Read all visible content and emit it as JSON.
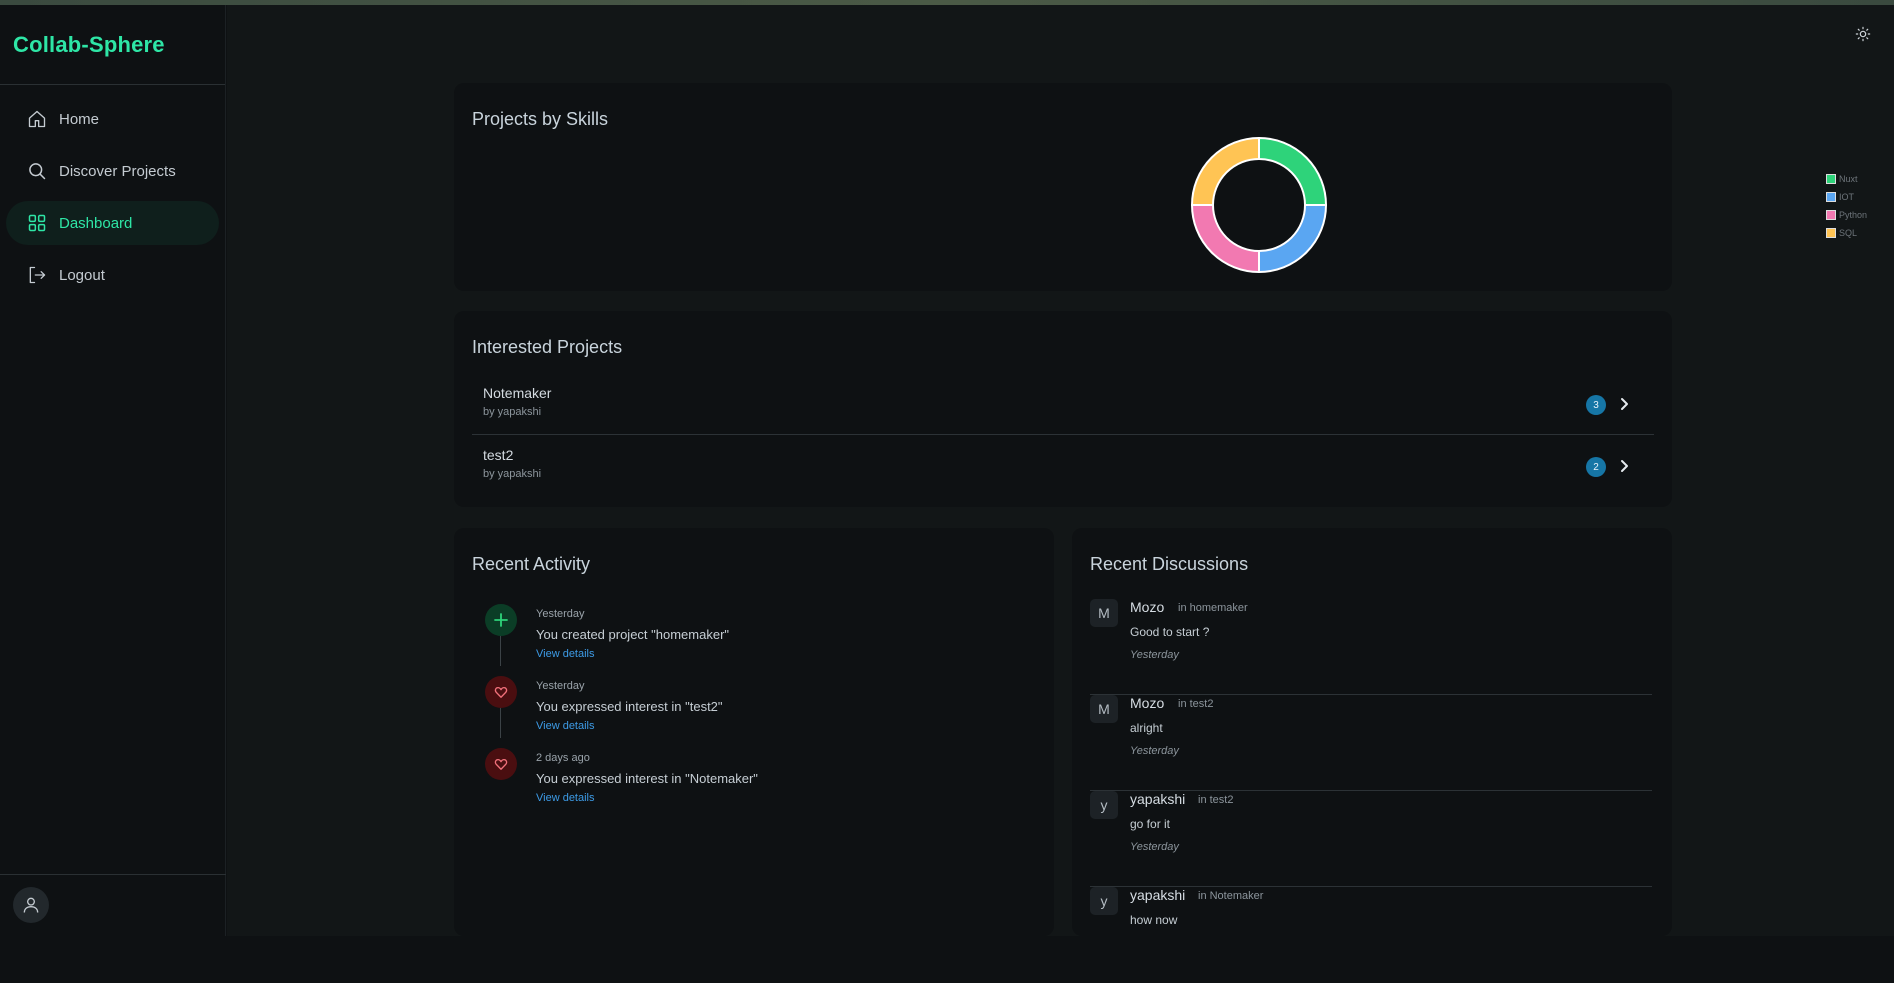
{
  "app": {
    "brand": "Collab-Sphere"
  },
  "sidebar": {
    "items": [
      {
        "label": "Home",
        "icon": "home-icon"
      },
      {
        "label": "Discover Projects",
        "icon": "search-icon"
      },
      {
        "label": "Dashboard",
        "icon": "grid-icon",
        "active": true
      },
      {
        "label": "Logout",
        "icon": "logout-icon"
      }
    ]
  },
  "colors": {
    "accent": "#2ee6a6",
    "badge": "#1676a6",
    "link": "#3d9be6"
  },
  "skills_chart": {
    "title": "Projects by Skills",
    "chart_data": {
      "type": "pie",
      "variant": "doughnut",
      "categories": [
        "Nuxt",
        "IOT",
        "Python",
        "SQL"
      ],
      "values": [
        1,
        1,
        1,
        1
      ],
      "colors": [
        "#2ed37a",
        "#5aa6f2",
        "#f279b1",
        "#ffc454"
      ],
      "legend": "right"
    }
  },
  "interested": {
    "title": "Interested Projects",
    "projects": [
      {
        "name": "Notemaker",
        "by": "by yapakshi",
        "count": "3"
      },
      {
        "name": "test2",
        "by": "by yapakshi",
        "count": "2"
      }
    ]
  },
  "activity": {
    "title": "Recent Activity",
    "items": [
      {
        "icon": "plus-icon",
        "time": "Yesterday",
        "text": "You created project \"homemaker\"",
        "link": "View details"
      },
      {
        "icon": "heart-icon",
        "time": "Yesterday",
        "text": "You expressed interest in \"test2\"",
        "link": "View details"
      },
      {
        "icon": "heart-icon",
        "time": "2 days ago",
        "text": "You expressed interest in \"Notemaker\"",
        "link": "View details"
      }
    ]
  },
  "discussions": {
    "title": "Recent Discussions",
    "items": [
      {
        "initial": "M",
        "author": "Mozo",
        "where": "in homemaker",
        "message": "Good to start ?",
        "time": "Yesterday"
      },
      {
        "initial": "M",
        "author": "Mozo",
        "where": "in test2",
        "message": "alright",
        "time": "Yesterday"
      },
      {
        "initial": "y",
        "author": "yapakshi",
        "where": "in test2",
        "message": "go for it",
        "time": "Yesterday"
      },
      {
        "initial": "y",
        "author": "yapakshi",
        "where": "in Notemaker",
        "message": "how now",
        "time": ""
      }
    ]
  }
}
